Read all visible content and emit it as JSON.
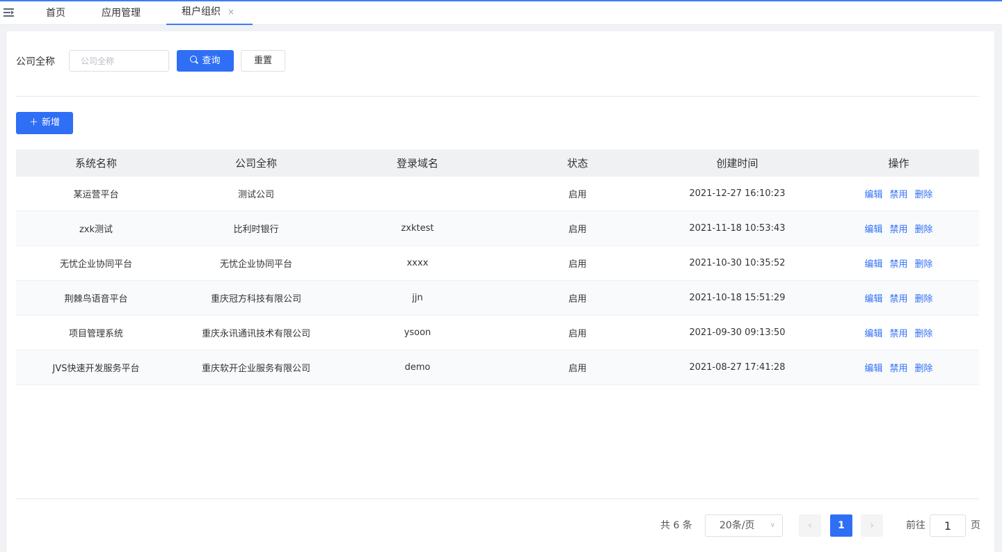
{
  "tabs": {
    "home": "首页",
    "app_management": "应用管理",
    "tenant_org": "租户组织",
    "close_glyph": "×"
  },
  "search": {
    "label": "公司全称",
    "placeholder": "公司全称",
    "query_label": "查询",
    "reset_label": "重置"
  },
  "toolbar": {
    "add_label": "新增",
    "add_glyph": "＋"
  },
  "table": {
    "headers": [
      "系统名称",
      "公司全称",
      "登录域名",
      "状态",
      "创建时间",
      "操作"
    ],
    "rows": [
      {
        "system": "某运营平台",
        "company": "测试公司",
        "domain": "",
        "status": "启用",
        "created": "2021-12-27 16:10:23"
      },
      {
        "system": "zxk测试",
        "company": "比利时银行",
        "domain": "zxktest",
        "status": "启用",
        "created": "2021-11-18 10:53:43"
      },
      {
        "system": "无忧企业协同平台",
        "company": "无忧企业协同平台",
        "domain": "xxxx",
        "status": "启用",
        "created": "2021-10-30 10:35:52"
      },
      {
        "system": "荆棘鸟语音平台",
        "company": "重庆冠方科技有限公司",
        "domain": "jjn",
        "status": "启用",
        "created": "2021-10-18 15:51:29"
      },
      {
        "system": "项目管理系统",
        "company": "重庆永讯通讯技术有限公司",
        "domain": "ysoon",
        "status": "启用",
        "created": "2021-09-30 09:13:50"
      },
      {
        "system": "JVS快速开发服务平台",
        "company": "重庆软开企业服务有限公司",
        "domain": "demo",
        "status": "启用",
        "created": "2021-08-27 17:41:28"
      }
    ],
    "actions": {
      "edit": "编辑",
      "disable": "禁用",
      "delete": "删除"
    }
  },
  "pagination": {
    "total_text": "共 6 条",
    "page_size": "20条/页",
    "current_page": "1",
    "prev_glyph": "‹",
    "next_glyph": "›",
    "goto_label": "前往",
    "goto_value": "1",
    "goto_suffix": "页",
    "chevron_glyph": "∨"
  },
  "colors": {
    "accent": "#2f6ff6",
    "header_bg": "#f0f1f3",
    "page_bg": "#f0f2f5"
  }
}
